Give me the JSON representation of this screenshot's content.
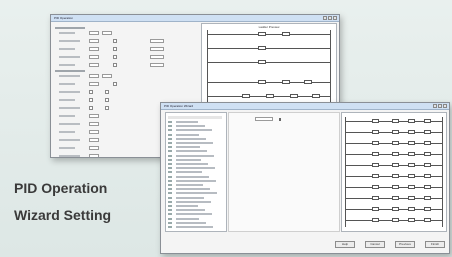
{
  "caption": {
    "line1": "PID Operation",
    "line2": "Wizard Setting"
  },
  "window1": {
    "title": "PID Operation",
    "ladder_title": "Ladder Preview"
  },
  "window2": {
    "title": "PID Operation Wizard",
    "buttons": [
      "Help",
      "Cancel",
      "Previous",
      "Finish"
    ]
  },
  "colors": {
    "background": "#e2ebe9",
    "titlebar": "#cfe0f3",
    "caption": "#3a3a3a"
  }
}
